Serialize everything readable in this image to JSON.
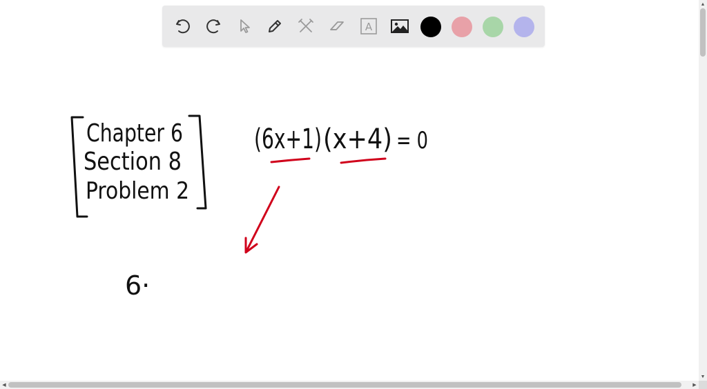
{
  "toolbar": {
    "tools": [
      {
        "name": "undo-icon"
      },
      {
        "name": "redo-icon"
      },
      {
        "name": "pointer-icon"
      },
      {
        "name": "pen-icon"
      },
      {
        "name": "tools-icon"
      },
      {
        "name": "eraser-icon"
      },
      {
        "name": "text-icon",
        "glyph": "A"
      },
      {
        "name": "image-icon"
      }
    ],
    "colors": [
      "#000000",
      "#e8a1a8",
      "#a8d6a8",
      "#b4b4ec"
    ],
    "selected_color": "#000000"
  },
  "canvas": {
    "problem_label": {
      "line1": "Chapter 6",
      "line2": "Section 8",
      "line3": "Problem 2"
    },
    "equation": {
      "factor1": "(6x+1)",
      "factor2": "(x+4)",
      "equals": "= 0"
    },
    "work": {
      "partial": "6·"
    },
    "accent_color": "#d0021b"
  }
}
